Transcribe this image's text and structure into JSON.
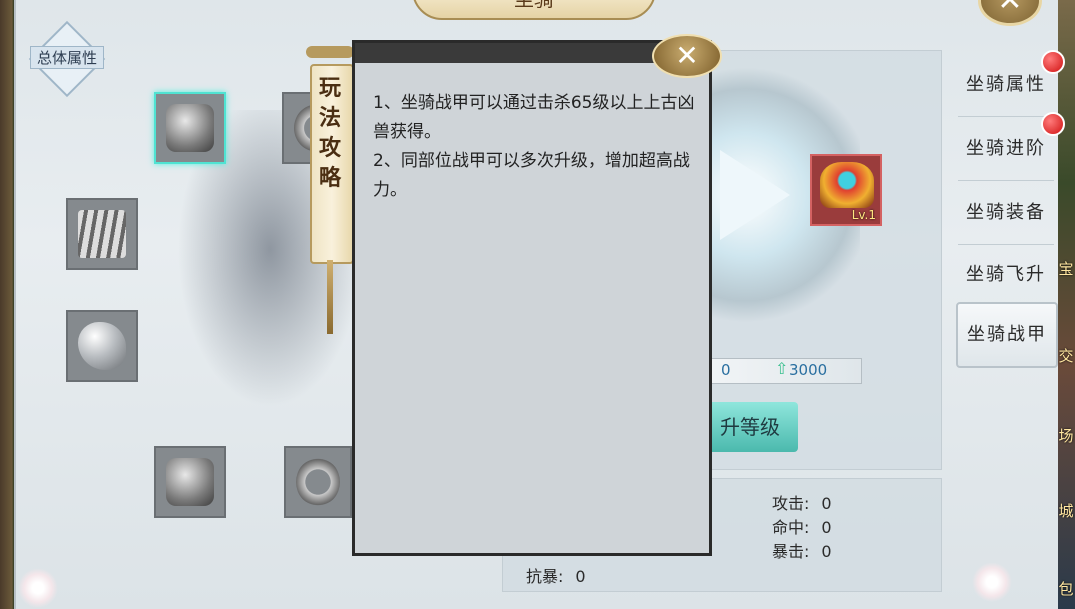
{
  "panel": {
    "title": "坐骑",
    "close_icon": "close-icon"
  },
  "total_attr": {
    "label": "总体属性"
  },
  "equipment_slots": [
    {
      "name": "helmet-slot",
      "icon": "helmet-icon",
      "selected": true
    },
    {
      "name": "chain-slot",
      "icon": "chain-icon",
      "selected": false
    },
    {
      "name": "body-armor-slot",
      "icon": "armor-icon",
      "selected": false
    },
    {
      "name": "gem-slot",
      "icon": "gem-icon",
      "selected": false
    },
    {
      "name": "bracer-slot",
      "icon": "bracer-icon",
      "selected": false
    },
    {
      "name": "ring-slot",
      "icon": "ring-icon",
      "selected": false
    }
  ],
  "guide": {
    "tab_label": "玩法攻略",
    "lines": [
      "1、坐骑战甲可以通过击杀65级以上上古凶兽获得。",
      "2、同部位战甲可以多次升级，增加超高战力。"
    ]
  },
  "selected_item": {
    "level_label": "Lv.1"
  },
  "exp": {
    "current": "0",
    "max": "3000"
  },
  "upgrade_button": "升等级",
  "stats": [
    {
      "label": "攻击:",
      "value": "0"
    },
    {
      "label": "命中:",
      "value": "0"
    },
    {
      "label": "暴击:",
      "value": "0"
    },
    {
      "label": "抗暴:",
      "value": "0"
    }
  ],
  "tabs": [
    {
      "label": "坐骑属性",
      "badge": true,
      "active": false
    },
    {
      "label": "坐骑进阶",
      "badge": true,
      "active": false
    },
    {
      "label": "坐骑装备",
      "badge": false,
      "active": false
    },
    {
      "label": "坐骑飞升",
      "badge": false,
      "active": false
    },
    {
      "label": "坐骑战甲",
      "badge": false,
      "active": true
    }
  ],
  "side_chars": [
    "宝",
    "交",
    "场",
    "城",
    "包"
  ],
  "colors": {
    "accent": "#4fe3d2",
    "badge": "#d01010",
    "item_frame": "#d46262"
  }
}
